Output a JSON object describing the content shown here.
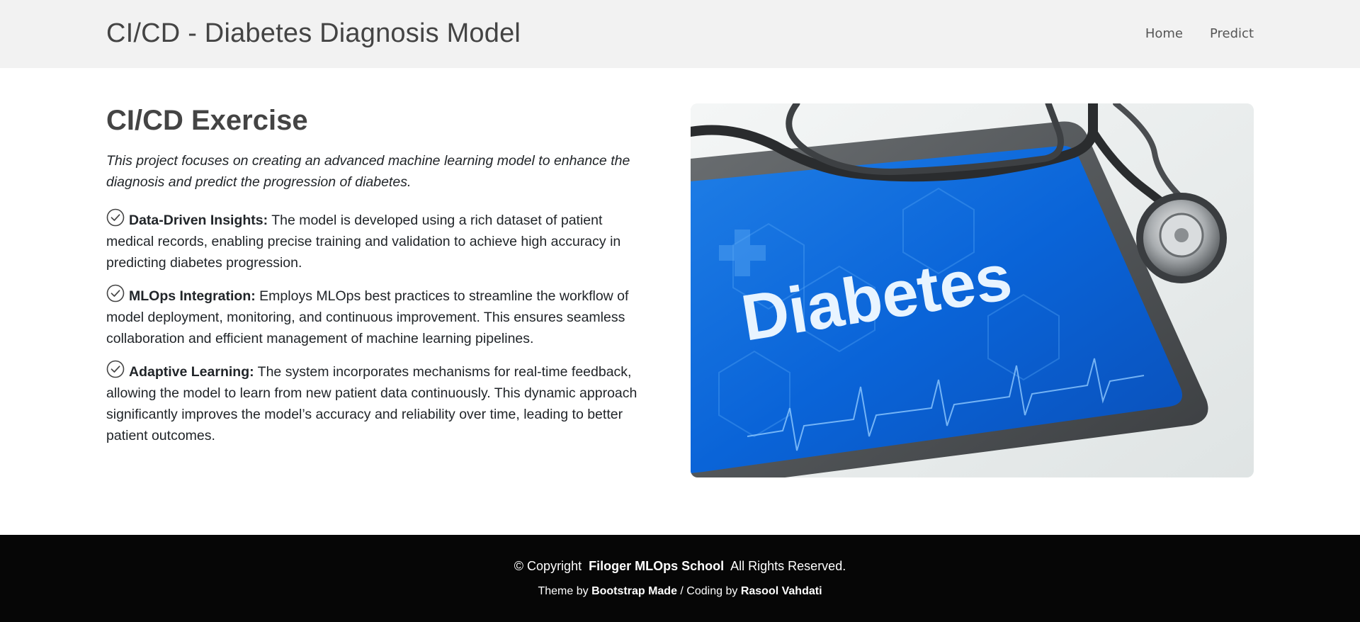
{
  "header": {
    "brand": "CI/CD - Diabetes Diagnosis Model",
    "nav": [
      {
        "label": "Home"
      },
      {
        "label": "Predict"
      }
    ]
  },
  "main": {
    "heading": "CI/CD Exercise",
    "lead": "This project focuses on creating an advanced machine learning model to enhance the diagnosis and predict the progression of diabetes.",
    "features": [
      {
        "title": "Data-Driven Insights:",
        "text": " The model is developed using a rich dataset of patient medical records, enabling precise training and validation to achieve high accuracy in predicting diabetes progression."
      },
      {
        "title": "MLOps Integration:",
        "text": " Employs MLOps best practices to streamline the workflow of model deployment, monitoring, and continuous improvement. This ensures seamless collaboration and efficient management of machine learning pipelines."
      },
      {
        "title": "Adaptive Learning:",
        "text": " The system incorporates mechanisms for real-time feedback, allowing the model to learn from new patient data continuously. This dynamic approach significantly improves the model’s accuracy and reliability over time, leading to better patient outcomes."
      }
    ],
    "image": {
      "screen_text": "Diabetes",
      "icon": "check-circle-icon"
    }
  },
  "footer": {
    "copyright_prefix": "© Copyright",
    "org": "Filoger MLOps School",
    "rights": "All Rights Reserved.",
    "theme_prefix": "Theme by",
    "theme_link": "Bootstrap Made",
    "coding_prefix": " / Coding by",
    "coder": "Rasool Vahdati"
  }
}
